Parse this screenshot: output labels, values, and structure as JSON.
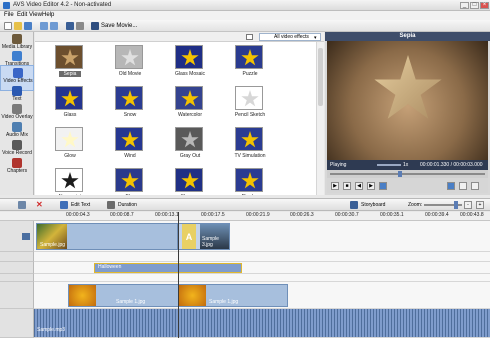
{
  "window": {
    "title": "AVS Video Editor 4.2 - Non-activated"
  },
  "menu": [
    "File",
    "Edit",
    "View",
    "Help"
  ],
  "toolbar": {
    "save_movie": "Save Movie..."
  },
  "sidebar": {
    "items": [
      {
        "label": "Media Library",
        "icon": "media-library-icon",
        "color": "#6d5a3c"
      },
      {
        "label": "Transitions",
        "icon": "transitions-icon",
        "color": "#3f7fcf"
      },
      {
        "label": "Video Effects",
        "icon": "video-effects-icon",
        "color": "#3a66c7",
        "active": true
      },
      {
        "label": "Text",
        "icon": "text-icon",
        "color": "#2b59b1"
      },
      {
        "label": "Video Overlay",
        "icon": "video-overlay-icon",
        "color": "#7a7a7a"
      },
      {
        "label": "Audio Mix",
        "icon": "audio-mix-icon",
        "color": "#4f7fb1"
      },
      {
        "label": "Voice Record",
        "icon": "voice-record-icon",
        "color": "#5a5a5a"
      },
      {
        "label": "Chapters",
        "icon": "chapters-icon",
        "color": "#b0352e"
      }
    ]
  },
  "effects": {
    "filter": "All video effects",
    "tiles": [
      {
        "label": "Sepia",
        "bg": "#6c4f2e",
        "star": "#c9a26a",
        "selected": true
      },
      {
        "label": "Old Movie",
        "bg": "#b7b7b7",
        "star": "#e0e0e0"
      },
      {
        "label": "Glass Mosaic",
        "bg": "#1f2e86",
        "star": "#f3c200"
      },
      {
        "label": "Puzzle",
        "bg": "#2a3b8f",
        "star": "#f3c200"
      },
      {
        "label": "Glass",
        "bg": "#25358f",
        "star": "#f3c200"
      },
      {
        "label": "Snow",
        "bg": "#2b3c92",
        "star": "#f3c200"
      },
      {
        "label": "Watercolor",
        "bg": "#34438f",
        "star": "#f3c200"
      },
      {
        "label": "Pencil Sketch",
        "bg": "#ffffff",
        "star": "#d7d7d7"
      },
      {
        "label": "Glow",
        "bg": "#f2f2f2",
        "star": "#fff8c8"
      },
      {
        "label": "Wind",
        "bg": "#263791",
        "star": "#f3c200"
      },
      {
        "label": "Gray Out",
        "bg": "#595959",
        "star": "#b7b7b7"
      },
      {
        "label": "TV Simulation",
        "bg": "#2b3c92",
        "star": "#f3c200"
      },
      {
        "label": "Newsprint",
        "bg": "#ffffff",
        "star": "#1c1c1c"
      },
      {
        "label": "Blur",
        "bg": "#2a3a8c",
        "star": "#f3c200"
      },
      {
        "label": "Sharpen",
        "bg": "#203085",
        "star": "#f3c200"
      },
      {
        "label": "Ripples",
        "bg": "#2b3c92",
        "star": "#f3c200"
      }
    ]
  },
  "preview": {
    "title": "Sepia",
    "status": "Playing",
    "speed": "1x",
    "time": "00:00:01.330 / 00:00:03.000"
  },
  "timeline_toolbar": {
    "edit_text": "Edit Text",
    "duration": "Duration",
    "storyboard": "Storyboard",
    "zoom": "Zoom:"
  },
  "ruler": [
    "00:00:04.3",
    "00:00:08.7",
    "00:00:13.1",
    "00:00:17.5",
    "00:00:21.9",
    "00:00:26.3",
    "00:00:30.7",
    "00:00:35.1",
    "00:00:39.4",
    "00:00:43.8"
  ],
  "tracks": {
    "video1": [
      "Sample.jpg",
      "Sample 3.jpg"
    ],
    "text": "Halloween",
    "video2": [
      "Sample 1.jpg",
      "Sample 1.jpg"
    ],
    "audio": "Sample.mp3"
  }
}
